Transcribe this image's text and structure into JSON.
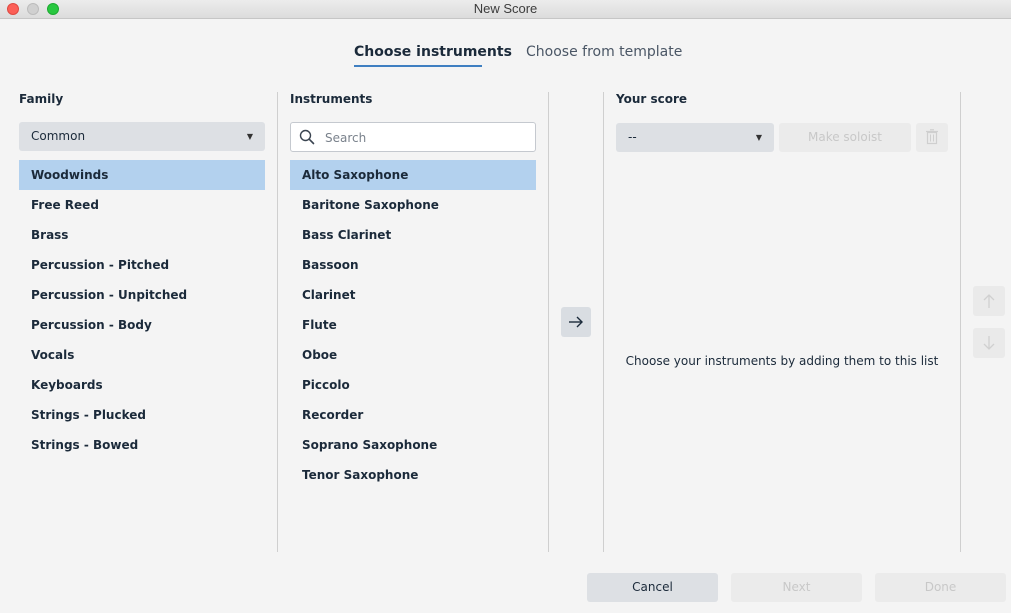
{
  "window": {
    "title": "New Score"
  },
  "tabs": [
    {
      "label": "Choose instruments",
      "active": true
    },
    {
      "label": "Choose from template",
      "active": false
    }
  ],
  "family": {
    "heading": "Family",
    "dropdown_value": "Common",
    "items": [
      {
        "label": "Woodwinds",
        "selected": true
      },
      {
        "label": "Free Reed"
      },
      {
        "label": "Brass"
      },
      {
        "label": "Percussion - Pitched"
      },
      {
        "label": "Percussion - Unpitched"
      },
      {
        "label": "Percussion - Body"
      },
      {
        "label": "Vocals"
      },
      {
        "label": "Keyboards"
      },
      {
        "label": "Strings - Plucked"
      },
      {
        "label": "Strings - Bowed"
      }
    ]
  },
  "instruments": {
    "heading": "Instruments",
    "search_placeholder": "Search",
    "search_value": "",
    "items": [
      {
        "label": "Alto Saxophone",
        "selected": true
      },
      {
        "label": "Baritone Saxophone"
      },
      {
        "label": "Bass Clarinet"
      },
      {
        "label": "Bassoon"
      },
      {
        "label": "Clarinet"
      },
      {
        "label": "Flute"
      },
      {
        "label": "Oboe"
      },
      {
        "label": "Piccolo"
      },
      {
        "label": "Recorder"
      },
      {
        "label": "Soprano Saxophone"
      },
      {
        "label": "Tenor Saxophone"
      }
    ]
  },
  "add_button": {
    "icon": "arrow-right-icon"
  },
  "your_score": {
    "heading": "Your score",
    "dropdown_value": "--",
    "make_soloist_label": "Make soloist",
    "delete_icon": "trash-icon",
    "empty_message": "Choose your instruments by adding them to this list",
    "move_up_icon": "arrow-up-icon",
    "move_down_icon": "arrow-down-icon"
  },
  "footer": {
    "cancel_label": "Cancel",
    "next_label": "Next",
    "done_label": "Done"
  },
  "colors": {
    "selection": "#b3d1ee",
    "tab_underline": "#3f7fc1",
    "background": "#f4f4f4"
  }
}
